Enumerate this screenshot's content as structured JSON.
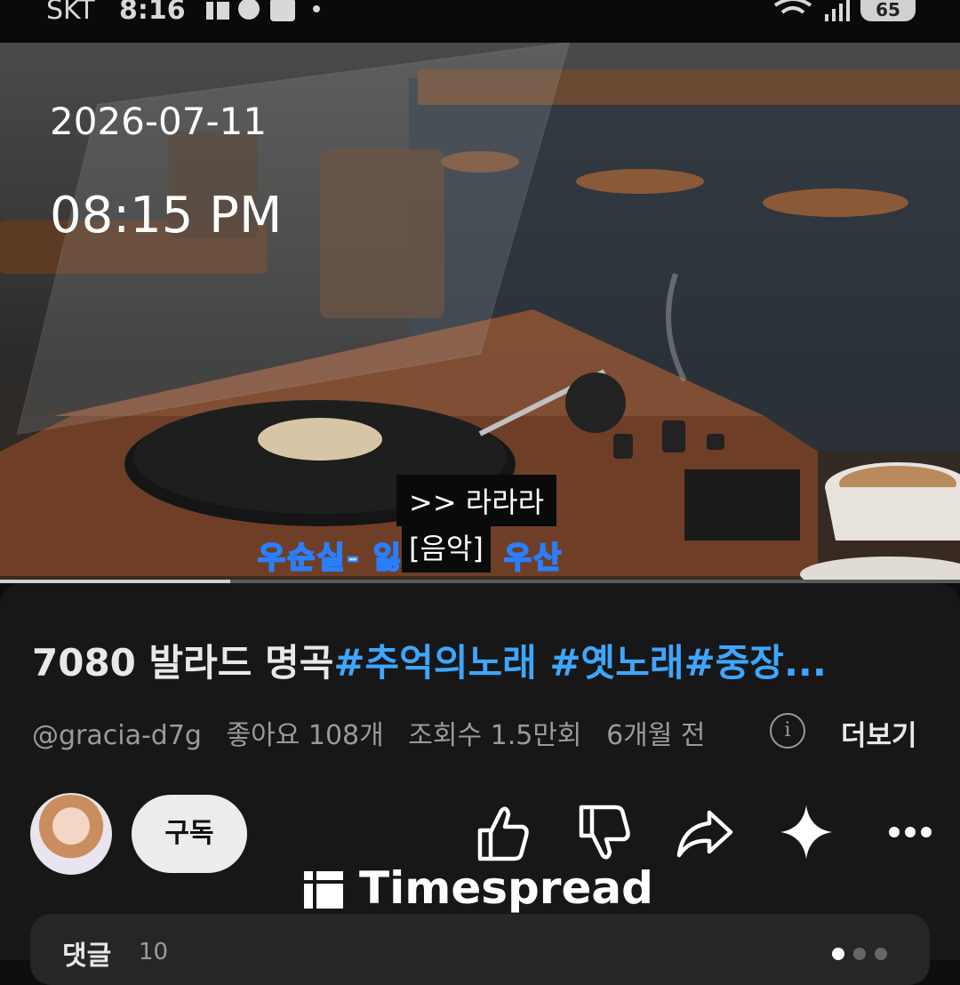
{
  "status_bar": {
    "carrier": "SKT",
    "time": "8:16",
    "battery": "65"
  },
  "video": {
    "overlay_date": "2026-07-11",
    "overlay_time": "08:15 PM",
    "caption_line1": ">> 라라라",
    "caption_line2": "[음악]",
    "lyric_text": "우순실- 잃어버린 우산",
    "progress": 0.24
  },
  "info": {
    "title_plain": "7080 발라드 명곡",
    "title_tags": "#추억의노래 #옛노래#중장...",
    "channel": "@gracia-d7g",
    "likes": "좋아요 108개",
    "views": "조회수 1.5만회",
    "age": "6개월 전",
    "more": "더보기",
    "info_icon": "i"
  },
  "actions": {
    "subscribe": "구독",
    "icons": [
      "thumbs-up-icon",
      "thumbs-down-icon",
      "share-icon",
      "sparkle-icon",
      "more-icon"
    ]
  },
  "brand": {
    "name": "Timespread"
  },
  "comments": {
    "label": "댓글",
    "count": "10"
  },
  "colors": {
    "accent": "#3ea6ff",
    "panel": "#171717",
    "lyric": "#2a7fff"
  }
}
